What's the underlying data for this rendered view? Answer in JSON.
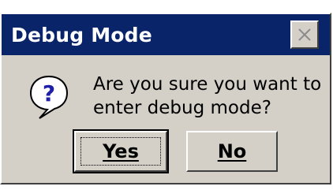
{
  "dialog": {
    "title": "Debug Mode",
    "message_line1": "Are you sure you want to",
    "message_line2": "enter debug mode?",
    "icon": "question-icon",
    "close_icon": "close-icon",
    "buttons": {
      "yes_label": "Yes",
      "no_label": "No"
    }
  },
  "colors": {
    "titlebar": "#0a246a",
    "dialog_bg": "#d4d0c8",
    "icon_blue": "#1e1ea8"
  }
}
